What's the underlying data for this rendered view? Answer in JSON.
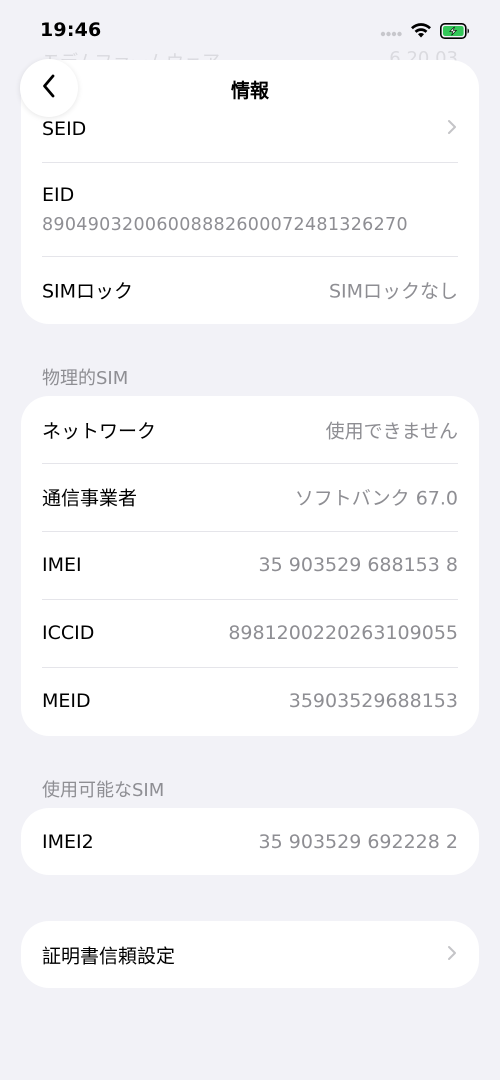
{
  "status_bar": {
    "time": "19:46"
  },
  "behind_header": {
    "label": "モデムファームウェア",
    "value": "6.20.03"
  },
  "nav": {
    "title": "情報"
  },
  "card1": {
    "seid_label": "SEID",
    "eid_label": "EID",
    "eid_value": "89049032006008882600072481326270",
    "simlock_label": "SIMロック",
    "simlock_value": "SIMロックなし"
  },
  "physical_sim": {
    "header": "物理的SIM",
    "rows": [
      {
        "label": "ネットワーク",
        "value": "使用できません"
      },
      {
        "label": "通信事業者",
        "value": "ソフトバンク 67.0"
      },
      {
        "label": "IMEI",
        "value": "35 903529 688153 8"
      },
      {
        "label": "ICCID",
        "value": "8981200220263109055"
      },
      {
        "label": "MEID",
        "value": "35903529688153"
      }
    ]
  },
  "available_sim": {
    "header": "使用可能なSIM",
    "rows": [
      {
        "label": "IMEI2",
        "value": "35 903529 692228 2"
      }
    ]
  },
  "cert_trust": {
    "label": "証明書信頼設定"
  },
  "colors": {
    "background": "#f2f2f7",
    "card": "#ffffff",
    "secondary_text": "#8e8e93",
    "battery_green": "#34c759"
  }
}
